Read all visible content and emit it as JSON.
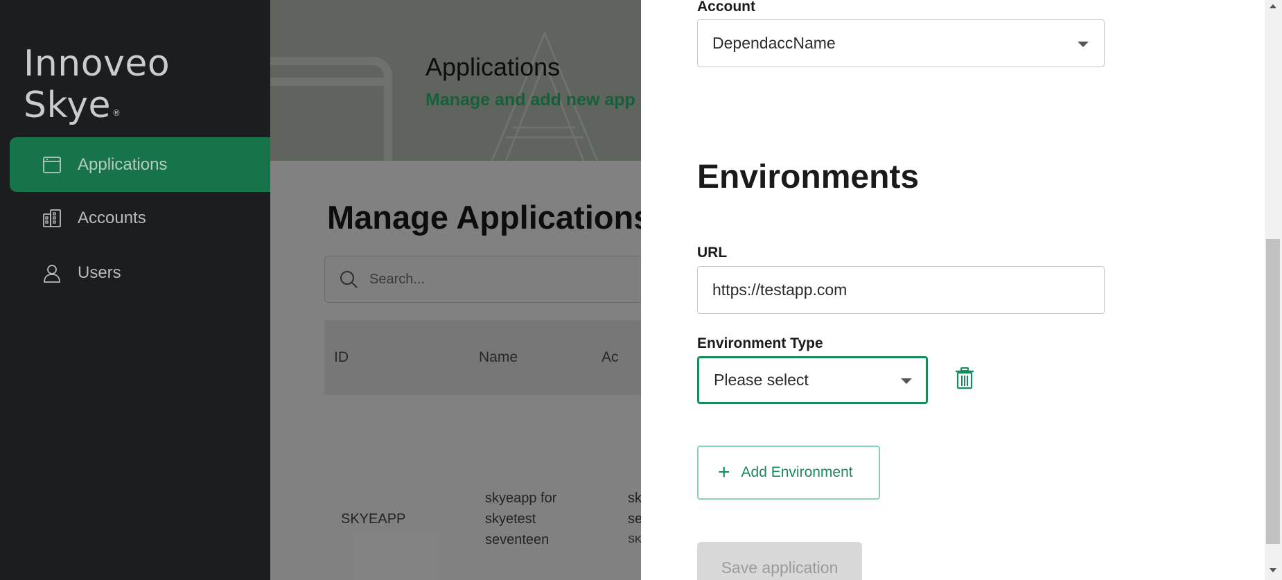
{
  "sidebar": {
    "logo": "Innoveo Skye",
    "logo_mark": "®",
    "items": [
      {
        "label": "Applications",
        "icon": "browser-window-icon",
        "active": true
      },
      {
        "label": "Accounts",
        "icon": "building-icon",
        "active": false
      },
      {
        "label": "Users",
        "icon": "user-icon",
        "active": false
      }
    ]
  },
  "main": {
    "hero_title": "Applications",
    "hero_subtitle": "Manage and add new app",
    "manage_title": "Manage Applications",
    "search_placeholder": "Search...",
    "table": {
      "headers": [
        "ID",
        "Name",
        "Ac"
      ],
      "rows": [
        {
          "id": "SKYEAPP",
          "name": [
            "skyeapp for",
            "skyetest",
            "seventeen"
          ],
          "account": [
            "sk",
            "se",
            "SK"
          ]
        }
      ]
    }
  },
  "panel": {
    "account_label": "Account",
    "account_value": "DependaccName",
    "environments_title": "Environments",
    "url_label": "URL",
    "url_value": "https://testapp.com",
    "env_type_label": "Environment Type",
    "env_type_value": "Please select",
    "add_environment_label": "Add Environment",
    "save_label": "Save application"
  },
  "colors": {
    "accent": "#1b8a5a",
    "sidebar_bg": "#1c1d1f",
    "active_nav": "#17744a"
  }
}
